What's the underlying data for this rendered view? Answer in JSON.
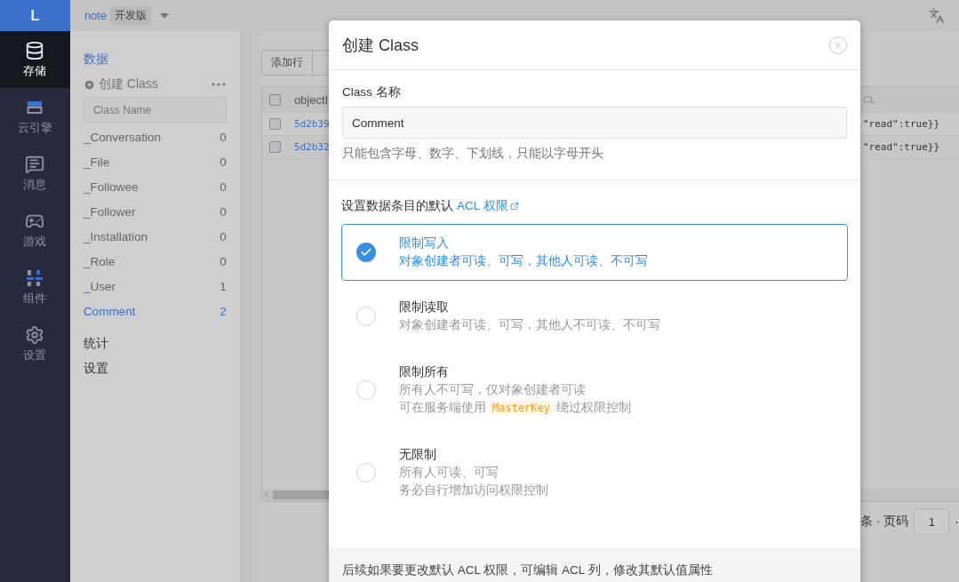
{
  "app": {
    "logo": "L",
    "project": "note",
    "env": "开发版"
  },
  "nav": [
    {
      "label": "存储",
      "selected": true
    },
    {
      "label": "云引擎",
      "selected": false
    },
    {
      "label": "消息",
      "selected": false
    },
    {
      "label": "游戏",
      "selected": false
    },
    {
      "label": "组件",
      "selected": false
    },
    {
      "label": "设置",
      "selected": false
    }
  ],
  "sidebar": {
    "heading": "数据",
    "create": "创建 Class",
    "placeholder": "Class Name",
    "classes": [
      {
        "name": "_Conversation",
        "count": "0",
        "selected": false
      },
      {
        "name": "_File",
        "count": "0",
        "selected": false
      },
      {
        "name": "_Followee",
        "count": "0",
        "selected": false
      },
      {
        "name": "_Follower",
        "count": "0",
        "selected": false
      },
      {
        "name": "_Installation",
        "count": "0",
        "selected": false
      },
      {
        "name": "_Role",
        "count": "0",
        "selected": false
      },
      {
        "name": "_User",
        "count": "1",
        "selected": false
      },
      {
        "name": "Comment",
        "count": "2",
        "selected": true
      }
    ],
    "links": [
      "统计",
      "设置"
    ]
  },
  "toolbar": {
    "buttons": [
      "添加行"
    ]
  },
  "table": {
    "header_checked": false,
    "columns": [
      "objectI",
      "CL"
    ],
    "rows": [
      {
        "checked": false,
        "id": "5d2b39",
        "acl": "\"read\":true}}"
      },
      {
        "checked": false,
        "id": "5d2b32",
        "acl": "\"read\":true}}"
      }
    ]
  },
  "pagination": {
    "label": "条 · 页码",
    "page": "1",
    "separator": "·"
  },
  "dialog": {
    "title": "创建 Class",
    "name_label": "Class 名称",
    "name_value": "Comment",
    "name_hint": "只能包含字母、数字、下划线，只能以字母开头",
    "acl_prefix": "设置数据条目的默认",
    "acl_link": "ACL 权限",
    "options": [
      {
        "title": "限制写入",
        "lines": [
          "对象创建者可读、可写，其他人可读、不可写"
        ],
        "selected": true
      },
      {
        "title": "限制读取",
        "lines": [
          "对象创建者可读、可写，其他人不可读、不可写"
        ],
        "selected": false
      },
      {
        "title": "限制所有",
        "lines": [
          "所有人不可写，仅对象创建者可读"
        ],
        "note": {
          "before": "可在服务端使用",
          "code": "MasterKey",
          "after": "绕过权限控制"
        },
        "selected": false
      },
      {
        "title": "无限制",
        "lines": [
          "所有人可读、可写",
          "务必自行增加访问权限控制"
        ],
        "selected": false
      }
    ],
    "footer": "后续如果要更改默认 ACL 权限，可编辑 ACL 列，修改其默认值属性"
  }
}
